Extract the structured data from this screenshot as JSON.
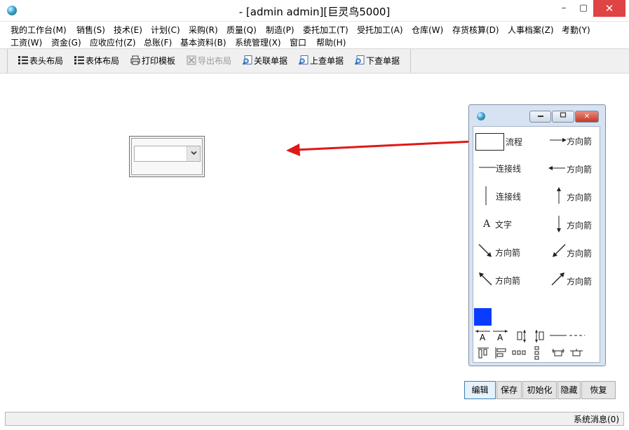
{
  "window": {
    "title": "-  [admin admin][巨灵鸟5000]",
    "min_glyph": "–",
    "max_glyph": "▢",
    "close_glyph": "✕"
  },
  "menu": {
    "row1": [
      "我的工作台(M)",
      "销售(S)",
      "技术(E)",
      "计划(C)",
      "采购(R)",
      "质量(Q)",
      "制造(P)",
      "委托加工(T)",
      "受托加工(A)",
      "仓库(W)",
      "存货核算(D)",
      "人事档案(Z)",
      "考勤(Y)"
    ],
    "row2": [
      "工资(W)",
      "资金(G)",
      "应收应付(Z)",
      "总账(F)",
      "基本资料(B)",
      "系统管理(X)",
      "窗口",
      "帮助(H)"
    ]
  },
  "toolbar": {
    "header_layout": "表头布局",
    "body_layout": "表体布局",
    "print_template": "打印模板",
    "export_layout": "导出布局",
    "related_docs": "关联单据",
    "prev_doc": "上查单据",
    "next_doc": "下查单据"
  },
  "palette": {
    "close_glyph": "✕",
    "tools": {
      "process": "流程",
      "arrow": "方向箭",
      "connector": "连接线",
      "text_glyph": "A",
      "text": "文字"
    },
    "align_glyph": "A",
    "fill_color": "#0a3cff"
  },
  "actions": {
    "edit": "编辑",
    "save": "保存",
    "init": "初始化",
    "hide": "隐藏",
    "restore": "恢复"
  },
  "status": {
    "message": "系统消息(0)"
  },
  "colors": {
    "arrow": "#e01818",
    "close": "#e04343"
  }
}
